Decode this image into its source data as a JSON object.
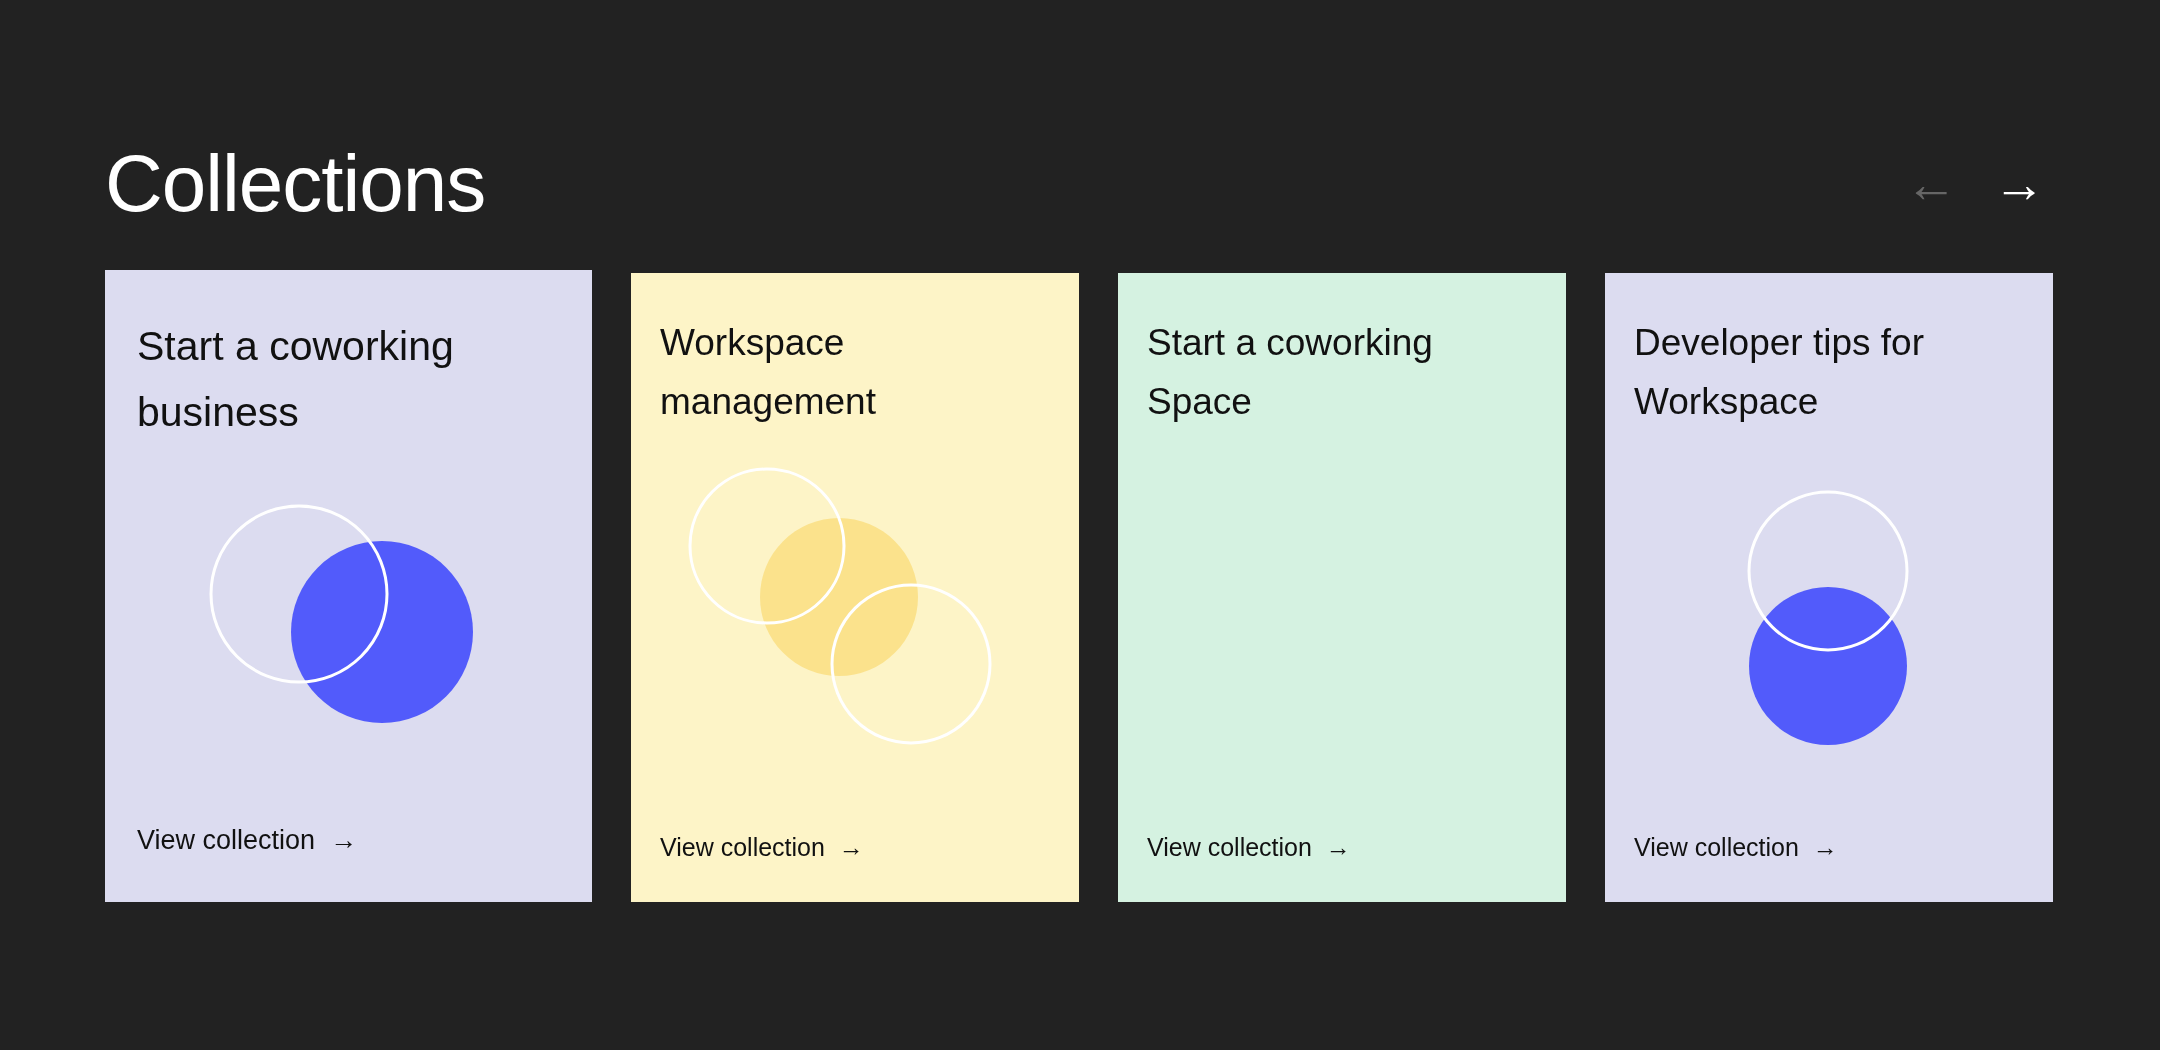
{
  "heading": "Collections",
  "nav": [
    {
      "symbol": "←",
      "disabled": true
    },
    {
      "symbol": "→",
      "disabled": false
    }
  ],
  "cards": [
    {
      "title": "Start a coworking business",
      "link": "View collection",
      "arrow": "→",
      "color": "#dcdcf0",
      "kind": "pair",
      "highlighted": true
    },
    {
      "title": "Workspace management",
      "link": "View collection",
      "arrow": "→",
      "color": "#fdf4c7",
      "kind": "triple",
      "highlighted": false
    },
    {
      "title": "Start a coworking Space",
      "link": "View collection",
      "arrow": "→",
      "color": "#d5f2e1",
      "kind": "plain",
      "highlighted": false
    },
    {
      "title": "Developer tips for Workspace",
      "link": "View collection",
      "arrow": "→",
      "color": "#dcdcf0",
      "kind": "stack",
      "highlighted": false
    }
  ]
}
